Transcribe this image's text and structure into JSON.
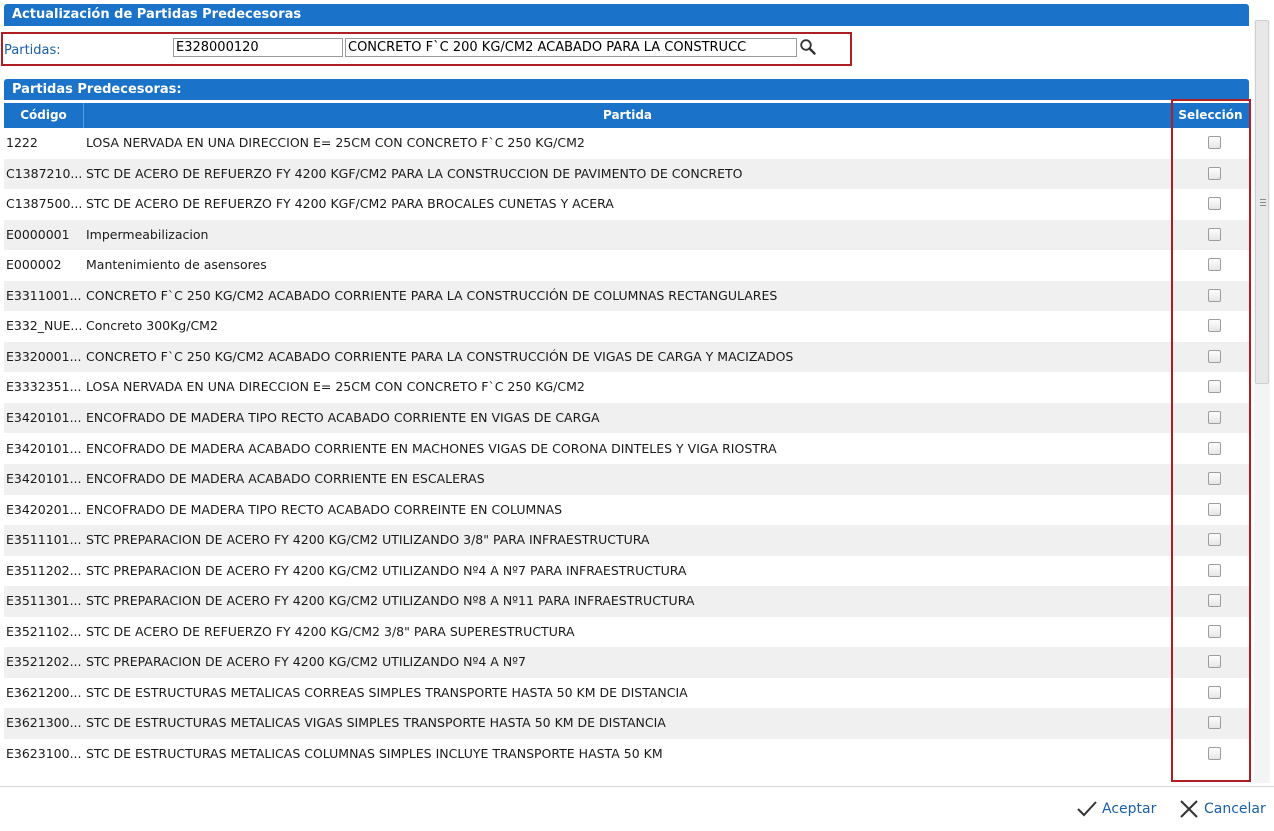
{
  "window": {
    "title": "Actualización de Partidas Predecesoras"
  },
  "filter": {
    "label": "Partidas:",
    "code_value": "E328000120",
    "description_value": "CONCRETO F`C 200 KG/CM2 ACABADO PARA LA CONSTRUCC",
    "search_icon": "search-icon"
  },
  "section": {
    "title": "Partidas Predecesoras:"
  },
  "columns": {
    "code": "Código",
    "partida": "Partida",
    "seleccion": "Selección"
  },
  "rows": [
    {
      "code": "1222",
      "desc": "LOSA NERVADA EN UNA DIRECCION E= 25CM CON CONCRETO F`C 250 KG/CM2",
      "checked": false
    },
    {
      "code": "C1387210...",
      "desc": "STC DE ACERO DE REFUERZO FY 4200 KGF/CM2 PARA LA CONSTRUCCION DE PAVIMENTO DE CONCRETO",
      "checked": false
    },
    {
      "code": "C1387500...",
      "desc": "STC DE ACERO DE REFUERZO FY 4200 KGF/CM2 PARA BROCALES CUNETAS Y ACERA",
      "checked": false
    },
    {
      "code": "E0000001",
      "desc": "Impermeabilizacion",
      "checked": false
    },
    {
      "code": "E000002",
      "desc": "Mantenimiento de asensores",
      "checked": false
    },
    {
      "code": "E3311001...",
      "desc": "CONCRETO F`C 250 KG/CM2 ACABADO CORRIENTE PARA LA CONSTRUCCIÓN DE COLUMNAS RECTANGULARES",
      "checked": false
    },
    {
      "code": "E332_NUE...",
      "desc": "Concreto 300Kg/CM2",
      "checked": false
    },
    {
      "code": "E3320001...",
      "desc": "CONCRETO F`C 250 KG/CM2 ACABADO CORRIENTE PARA LA CONSTRUCCIÓN DE VIGAS DE CARGA Y MACIZADOS",
      "checked": false
    },
    {
      "code": "E3332351...",
      "desc": "LOSA NERVADA EN UNA DIRECCION E= 25CM CON CONCRETO F`C 250 KG/CM2",
      "checked": false
    },
    {
      "code": "E3420101...",
      "desc": "ENCOFRADO DE MADERA TIPO RECTO ACABADO CORRIENTE EN VIGAS DE CARGA",
      "checked": false
    },
    {
      "code": "E3420101...",
      "desc": "ENCOFRADO DE MADERA ACABADO CORRIENTE EN MACHONES VIGAS DE CORONA DINTELES Y VIGA RIOSTRA",
      "checked": false
    },
    {
      "code": "E3420101...",
      "desc": "ENCOFRADO DE MADERA ACABADO CORRIENTE EN ESCALERAS",
      "checked": false
    },
    {
      "code": "E3420201...",
      "desc": "ENCOFRADO DE MADERA TIPO RECTO ACABADO CORREINTE EN COLUMNAS",
      "checked": false
    },
    {
      "code": "E3511101...",
      "desc": "STC PREPARACION DE ACERO FY 4200 KG/CM2 UTILIZANDO 3/8\" PARA INFRAESTRUCTURA",
      "checked": false
    },
    {
      "code": "E3511202...",
      "desc": "STC PREPARACION DE ACERO FY 4200 KG/CM2 UTILIZANDO Nº4 A Nº7 PARA INFRAESTRUCTURA",
      "checked": false
    },
    {
      "code": "E3511301...",
      "desc": "STC PREPARACION DE ACERO FY 4200 KG/CM2 UTILIZANDO Nº8 A Nº11 PARA INFRAESTRUCTURA",
      "checked": false
    },
    {
      "code": "E3521102...",
      "desc": "STC DE ACERO DE REFUERZO FY 4200 KG/CM2 3/8\" PARA SUPERESTRUCTURA",
      "checked": false
    },
    {
      "code": "E3521202...",
      "desc": "STC PREPARACION DE ACERO FY 4200 KG/CM2 UTILIZANDO Nº4 A Nº7",
      "checked": false
    },
    {
      "code": "E3621200...",
      "desc": "STC DE ESTRUCTURAS METALICAS CORREAS SIMPLES TRANSPORTE HASTA 50 KM DE DISTANCIA",
      "checked": false
    },
    {
      "code": "E3621300...",
      "desc": "STC DE ESTRUCTURAS METALICAS VIGAS SIMPLES TRANSPORTE HASTA 50 KM DE DISTANCIA",
      "checked": false
    },
    {
      "code": "E3623100...",
      "desc": "STC DE ESTRUCTURAS METALICAS COLUMNAS SIMPLES INCLUYE TRANSPORTE HASTA 50 KM",
      "checked": false
    }
  ],
  "footer": {
    "accept_label": "Aceptar",
    "accept_icon": "checkmark-icon",
    "cancel_label": "Cancelar",
    "cancel_icon": "close-icon"
  },
  "colors": {
    "header_blue": "#1a73c9",
    "highlight_red": "#b01e23",
    "link_blue": "#1a5fa8"
  }
}
